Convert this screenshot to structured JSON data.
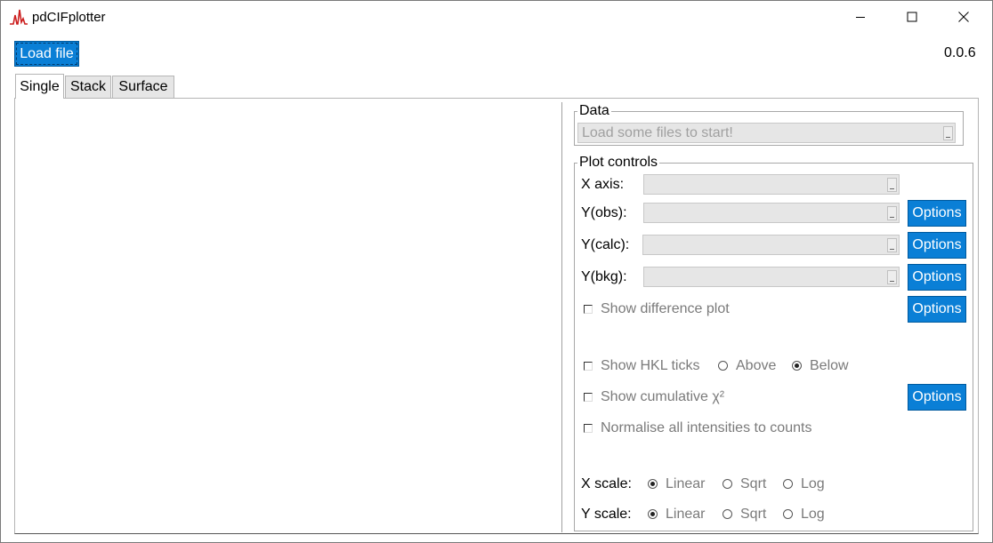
{
  "window": {
    "title": "pdCIFplotter",
    "controls": [
      "minimize-icon",
      "maximize-icon",
      "close-icon"
    ]
  },
  "toolbar": {
    "load_label": "Load file",
    "version": "0.0.6"
  },
  "tabs": [
    {
      "label": "Single",
      "active": true
    },
    {
      "label": "Stack",
      "active": false
    },
    {
      "label": "Surface",
      "active": false
    }
  ],
  "data_group": {
    "legend": "Data",
    "placeholder": "Load some files to start!"
  },
  "plot_controls": {
    "legend": "Plot controls",
    "x_axis_label": "X axis:",
    "yobs_label": "Y(obs):",
    "ycalc_label": "Y(calc):",
    "ybkg_label": "Y(bkg):",
    "options_label": "Options",
    "show_diff": {
      "label": "Show difference plot",
      "checked": false
    },
    "show_hkl": {
      "label": "Show HKL ticks",
      "checked": false
    },
    "hkl_above": {
      "label": "Above",
      "selected": false
    },
    "hkl_below": {
      "label": "Below",
      "selected": true
    },
    "show_chi2": {
      "label": "Show cumulative χ²",
      "checked": false
    },
    "normalise": {
      "label": "Normalise all intensities to counts",
      "checked": false
    },
    "x_scale": {
      "label": "X scale:",
      "options": [
        "Linear",
        "Sqrt",
        "Log"
      ],
      "selected": "Linear"
    },
    "y_scale": {
      "label": "Y scale:",
      "options": [
        "Linear",
        "Sqrt",
        "Log"
      ],
      "selected": "Linear"
    }
  },
  "colors": {
    "accent": "#0a7fd6",
    "disabled_text": "#7a7a7a",
    "combo_bg": "#e6e6e6"
  }
}
